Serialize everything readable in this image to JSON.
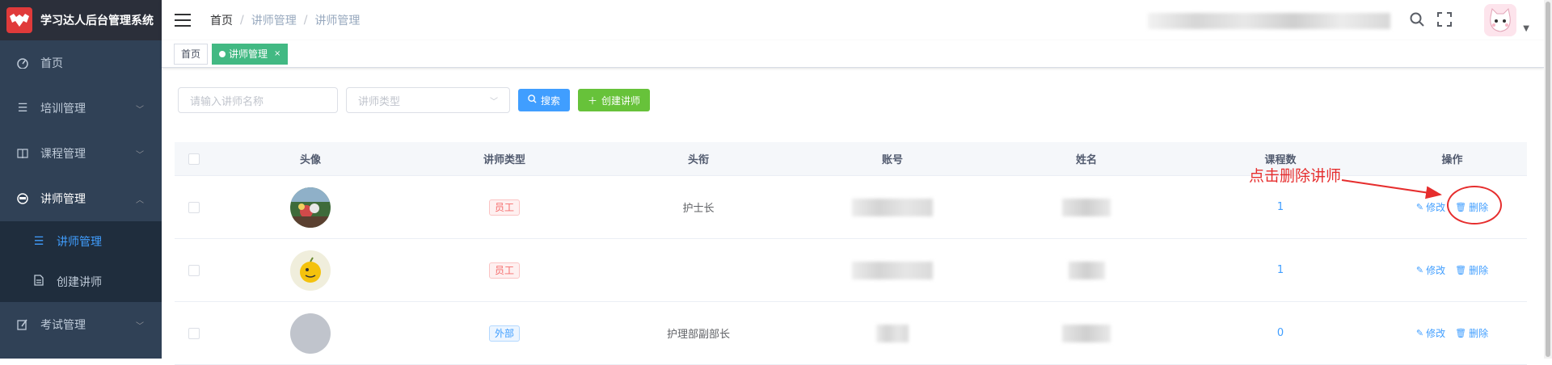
{
  "app": {
    "title": "学习达人后台管理系统"
  },
  "sidebar": {
    "items": [
      {
        "label": "首页",
        "icon": "dashboard-icon"
      },
      {
        "label": "培训管理",
        "icon": "list-icon"
      },
      {
        "label": "课程管理",
        "icon": "book-icon"
      },
      {
        "label": "讲师管理",
        "icon": "teacher-icon"
      },
      {
        "label": "考试管理",
        "icon": "edit-icon"
      }
    ],
    "sub_items": [
      {
        "label": "讲师管理",
        "icon": "list-icon"
      },
      {
        "label": "创建讲师",
        "icon": "document-icon"
      }
    ]
  },
  "breadcrumb": {
    "home": "首页",
    "level1": "讲师管理",
    "level2": "讲师管理",
    "sep": "/"
  },
  "tags": {
    "home": "首页",
    "current": "讲师管理",
    "close": "×"
  },
  "filters": {
    "name_placeholder": "请输入讲师名称",
    "type_placeholder": "讲师类型",
    "search_label": "搜索",
    "create_label": "创建讲师"
  },
  "table": {
    "headers": [
      "头像",
      "讲师类型",
      "头衔",
      "账号",
      "姓名",
      "课程数",
      "操作"
    ],
    "rows": [
      {
        "type": "员工",
        "type_kind": "staff",
        "title": "护士长",
        "courses": "1"
      },
      {
        "type": "员工",
        "type_kind": "staff",
        "title": "",
        "courses": "1"
      },
      {
        "type": "外部",
        "type_kind": "ext",
        "title": "护理部副部长",
        "courses": "0"
      }
    ],
    "edit_label": "修改",
    "delete_label": "删除"
  },
  "annotation": {
    "text": "点击删除讲师",
    "color": "#e62e2e"
  },
  "colors": {
    "sidebar": "#304156",
    "primary": "#409eff",
    "success": "#67c23a",
    "tag_active": "#42b983"
  }
}
